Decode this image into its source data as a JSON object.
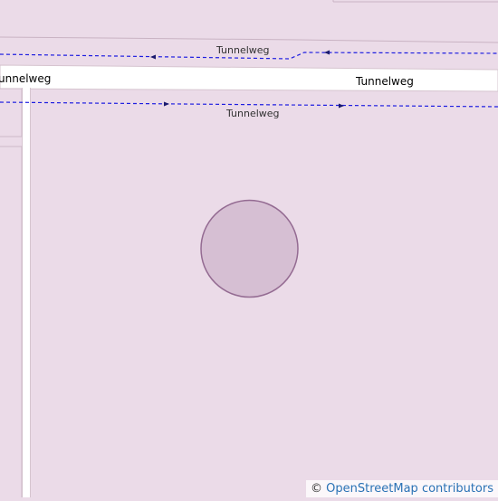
{
  "map": {
    "background_color": "#ebdbe8",
    "road": {
      "name_left": "unnelweg",
      "name_right": "Tunnelweg",
      "color": "#ffffff",
      "casing_color": "#d6c4cf"
    },
    "footpaths": [
      {
        "label": "Tunnelweg",
        "color": "#1e1ee0"
      },
      {
        "label": "Tunnelweg",
        "color": "#1e1ee0"
      }
    ],
    "circle_feature": {
      "fill": "#d6bfd3",
      "stroke": "#946b92"
    }
  },
  "attribution": {
    "symbol": "©",
    "text": "OpenStreetMap contributors"
  }
}
